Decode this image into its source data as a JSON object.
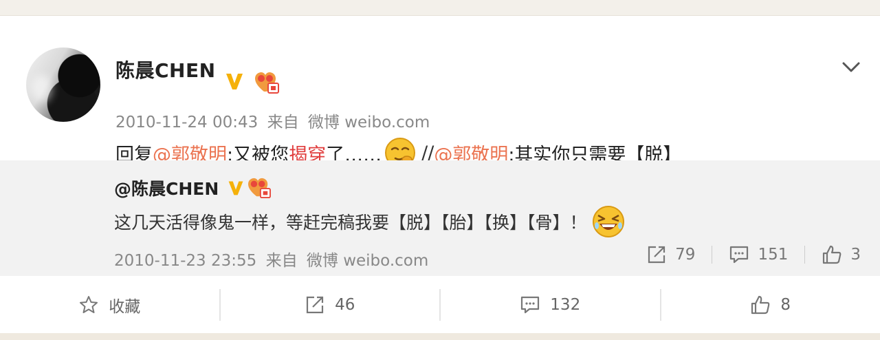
{
  "post": {
    "user_name": "陈晨CHEN",
    "timestamp": "2010-11-24 00:43",
    "source_prefix": "来自",
    "source": "微博 weibo.com",
    "text": {
      "reply_prefix": "回复",
      "mention1": "@郭敬明",
      "part1": ":又被您",
      "highlight": "揭穿",
      "part2": "了……",
      "sep": "//",
      "mention2": "@郭敬明",
      "part3": ":其实你只需要【脱】"
    }
  },
  "repost": {
    "user_name": "@陈晨CHEN",
    "text": "这几天活得像鬼一样，等赶完稿我要【脱】【胎】【换】【骨】！",
    "timestamp": "2010-11-23 23:55",
    "source_prefix": "来自",
    "source": "微博 weibo.com",
    "reposts": "79",
    "comments": "151",
    "likes": "3"
  },
  "footer": {
    "favorite_label": "收藏",
    "reposts": "46",
    "comments": "132",
    "likes": "8"
  },
  "icons": {
    "verified": "verified-v-icon",
    "member": "heart-member-icon",
    "menu": "chevron-down-icon",
    "repost": "repost-icon",
    "comment": "comment-icon",
    "like": "thumbs-up-icon",
    "favorite": "star-icon"
  },
  "colors": {
    "mention": "#eb7350",
    "highlight": "#e03c3c",
    "verified": "#f5b10a",
    "repost_bg": "#f2f2f2"
  }
}
